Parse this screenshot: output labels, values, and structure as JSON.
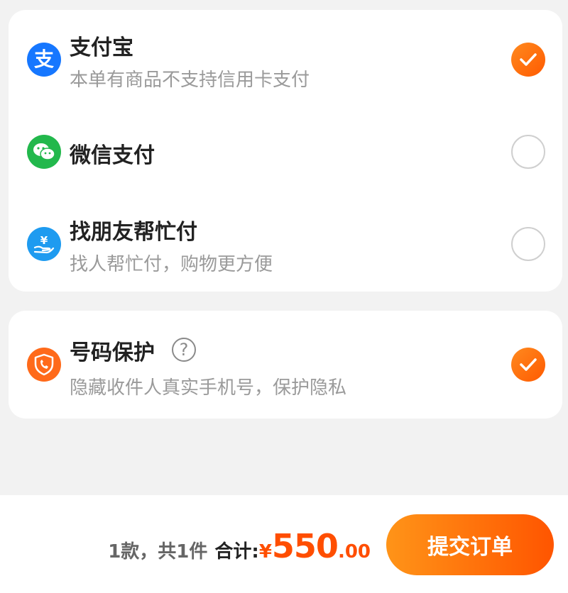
{
  "payment_methods": [
    {
      "name": "支付宝",
      "note": "本单有商品不支持信用卡支付",
      "icon": "alipay-icon",
      "icon_glyph": "支",
      "selected": true,
      "color": "#1677ff"
    },
    {
      "name": "微信支付",
      "note": "",
      "icon": "wechat-pay-icon",
      "selected": false,
      "color": "#22b84c"
    },
    {
      "name": "找朋友帮忙付",
      "note": "找人帮忙付，购物更方便",
      "icon": "friend-pay-icon",
      "icon_glyph": "¥",
      "selected": false,
      "color": "#1e9bf0"
    }
  ],
  "number_protection": {
    "title": "号码保护",
    "help_glyph": "?",
    "note": "隐藏收件人真实手机号，保护隐私",
    "icon": "phone-shield-icon",
    "enabled": true,
    "color": "#ff6a1a"
  },
  "footer": {
    "count_text": "1款，共1件",
    "total_label": "合计:",
    "currency": "¥",
    "amount_int": "550",
    "amount_dec": ".00",
    "submit_label": "提交订单",
    "accent": "#ff5a00"
  }
}
